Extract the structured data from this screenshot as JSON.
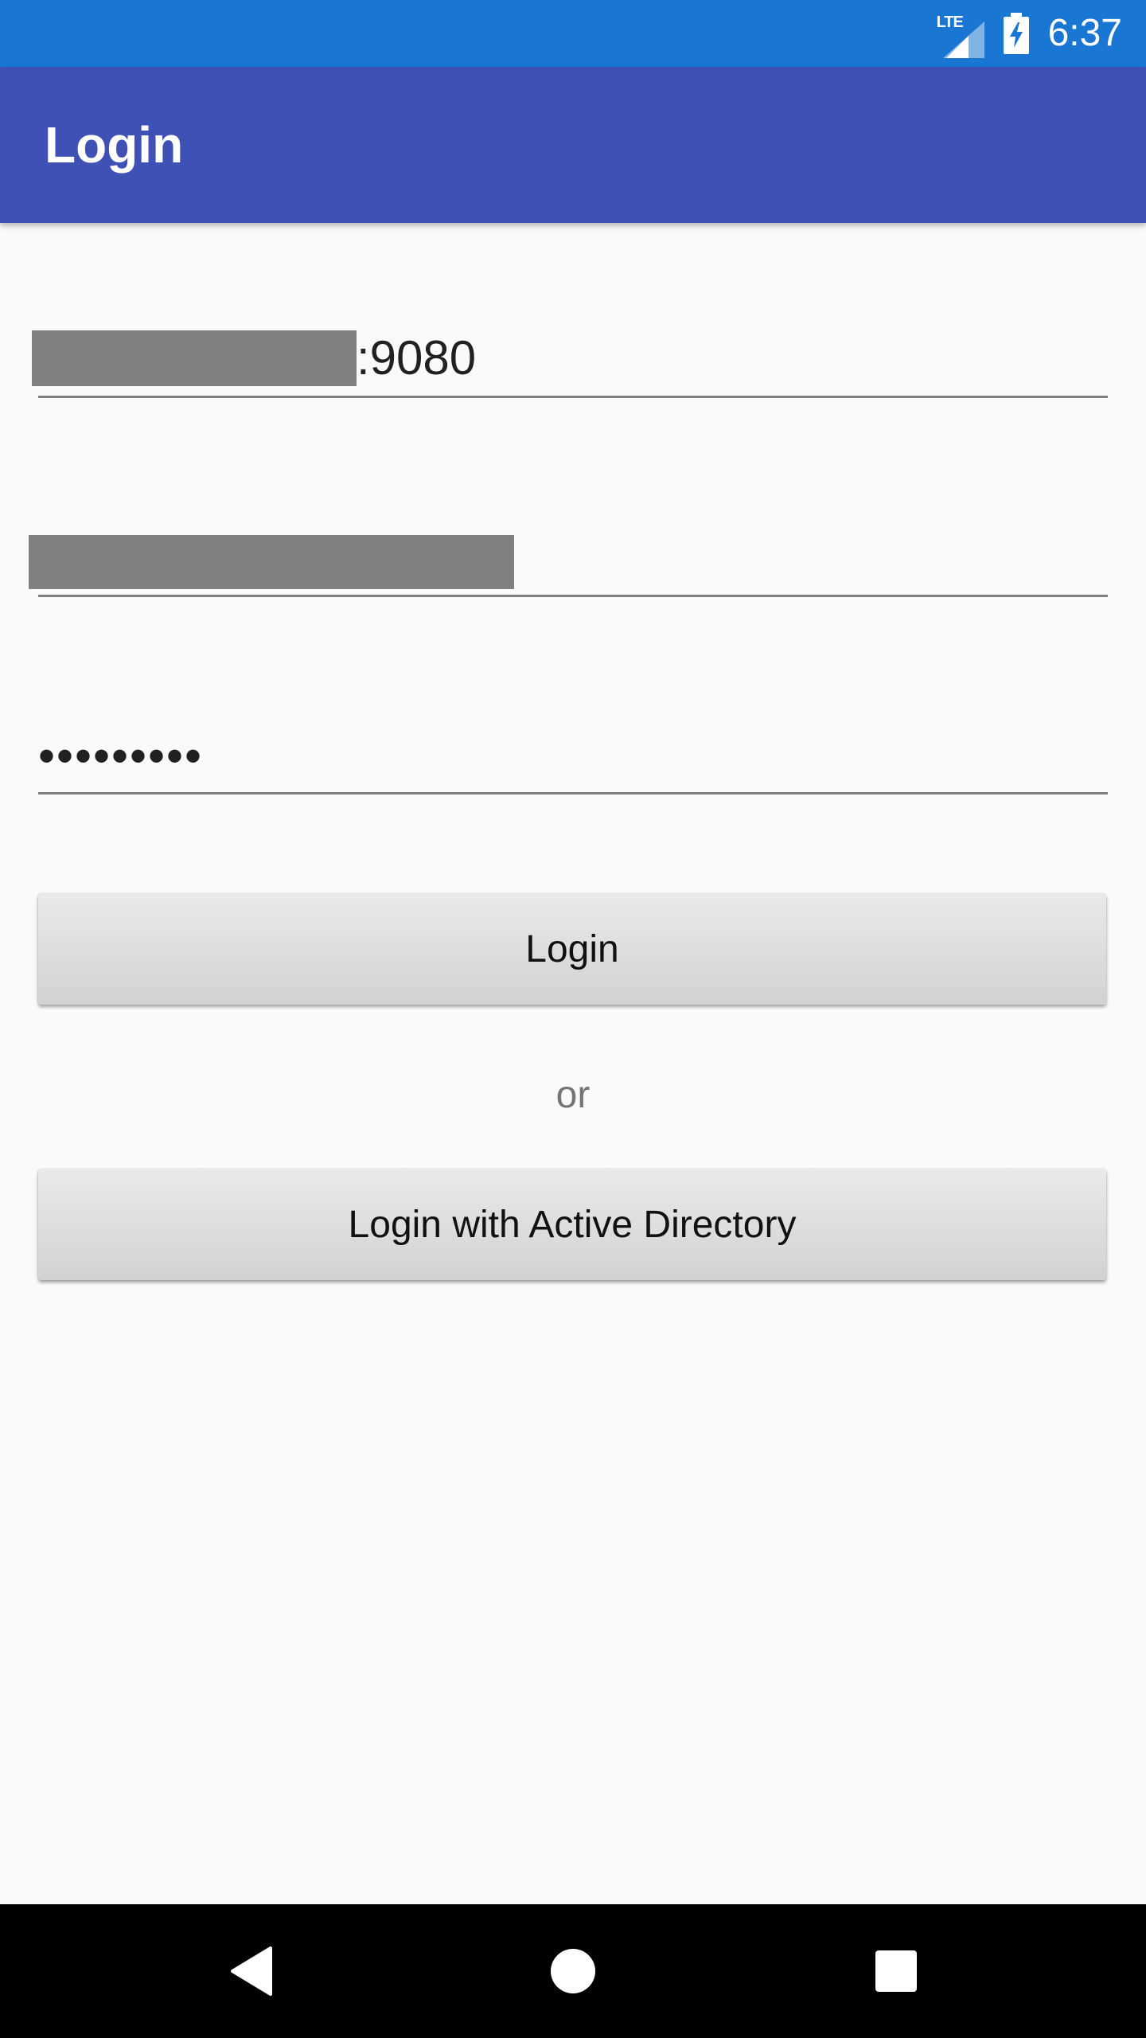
{
  "status_bar": {
    "network": "LTE",
    "time": "6:37",
    "icons": [
      "lte-signal-icon",
      "battery-charging-icon"
    ]
  },
  "app_bar": {
    "title": "Login"
  },
  "form": {
    "server_field": {
      "value_suffix": ":9080"
    },
    "username_field": {
      "value": ""
    },
    "password_field": {
      "value": "•••••••••"
    },
    "login_button_label": "Login",
    "separator_text": "or",
    "ad_login_button_label": "Login with Active Directory"
  },
  "nav_bar": {
    "icons": [
      "back-icon",
      "home-icon",
      "recents-icon"
    ]
  },
  "colors": {
    "status_bar": "#1976d2",
    "app_bar": "#3f51b5",
    "background": "#fafafa",
    "redaction": "#808080",
    "nav_bar": "#000000"
  }
}
